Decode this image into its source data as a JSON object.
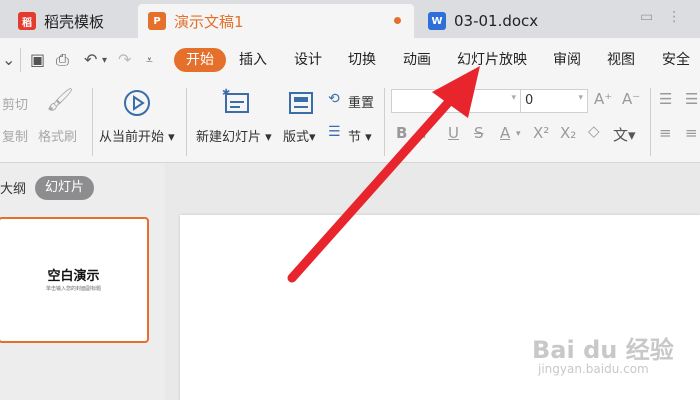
{
  "tabs": [
    {
      "label": "稻壳模板",
      "icon": "daoke-logo-icon"
    },
    {
      "label": "演示文稿1",
      "icon": "presentation-icon"
    },
    {
      "label": "03-01.docx",
      "icon": "word-doc-icon"
    }
  ],
  "menu": [
    "开始",
    "插入",
    "设计",
    "切换",
    "动画",
    "幻灯片放映",
    "审阅",
    "视图",
    "安全"
  ],
  "ribbon": {
    "cut": "剪切",
    "copy": "复制",
    "format_painter": "格式刷",
    "play_from_current": "从当前开始",
    "new_slide": "新建幻灯片",
    "layout": "版式",
    "reset": "重置",
    "section": "节",
    "font_size": "0"
  },
  "left_panel": {
    "outline_tab": "大纲",
    "slides_tab": "幻灯片",
    "thumb_title": "空白演示",
    "thumb_subtitle": "单击输入您的封面副标题"
  },
  "watermark": {
    "main": "Bai du 经验",
    "sub": "jingyan.baidu.com"
  },
  "colors": {
    "accent": "#e5702b",
    "arrow": "#e8252d"
  }
}
